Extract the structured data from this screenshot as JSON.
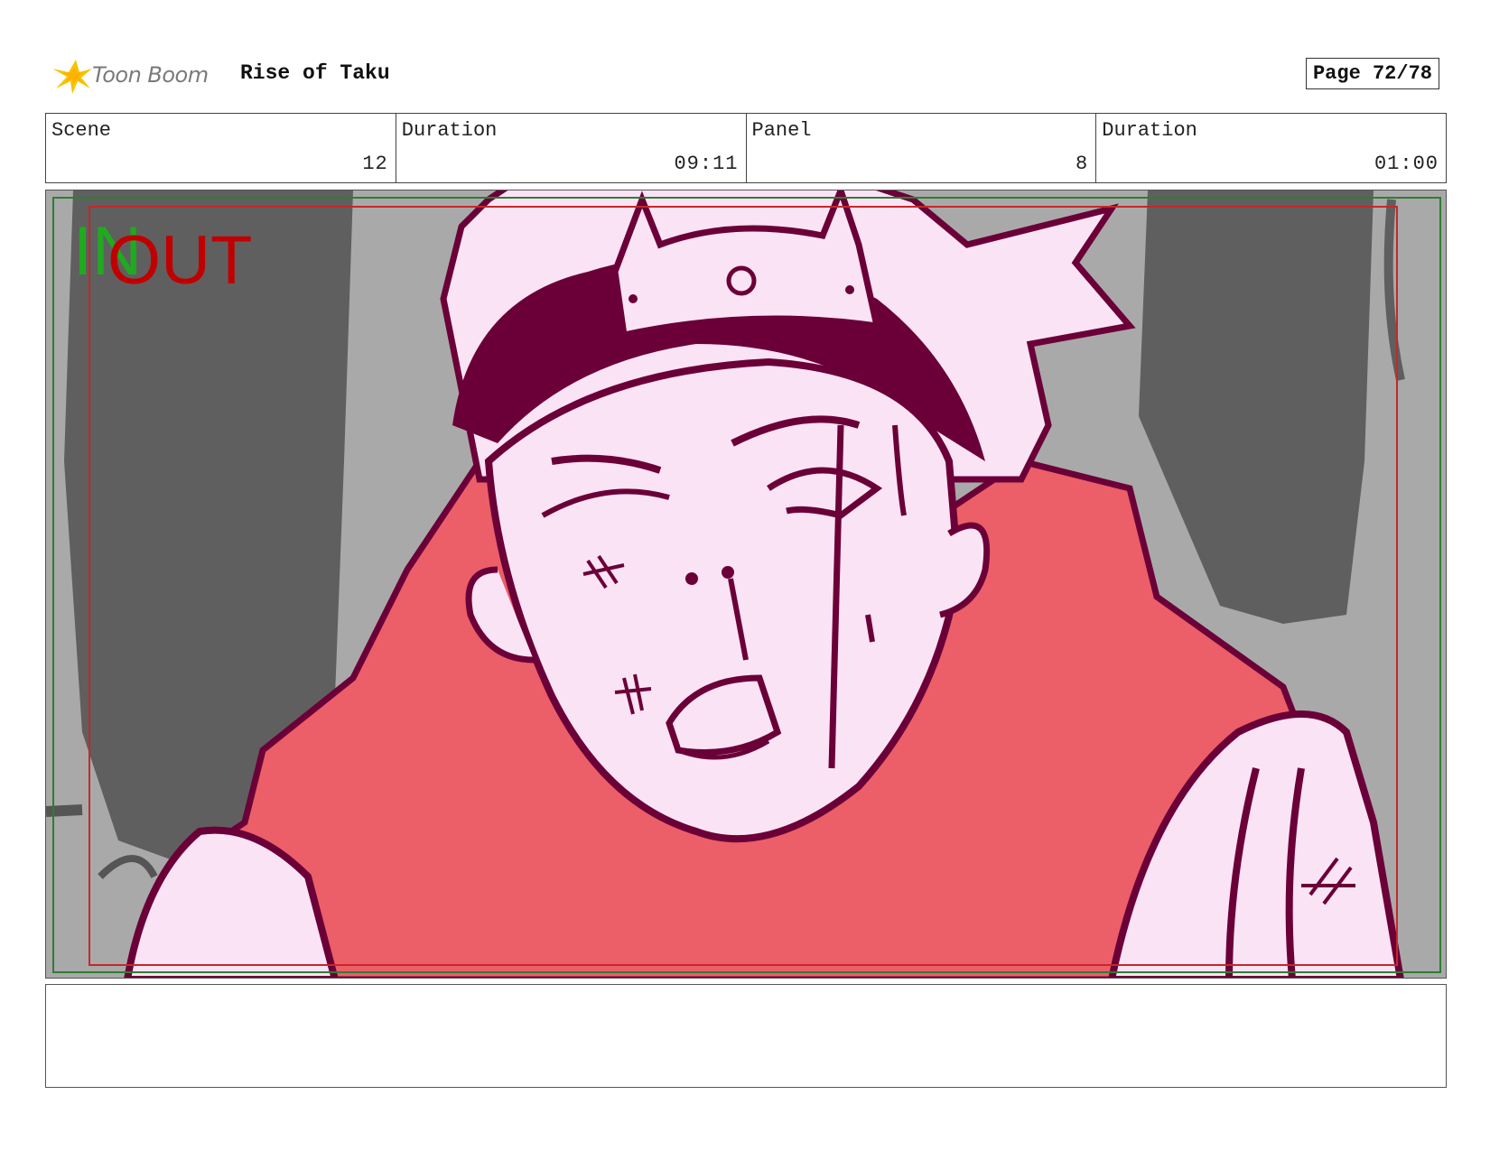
{
  "header": {
    "brand": "Toon Boom",
    "project_title": "Rise of Taku",
    "page_label": "Page 72/78"
  },
  "info": {
    "scene_label": "Scene",
    "scene_value": "12",
    "scene_duration_label": "Duration",
    "scene_duration_value": "09:11",
    "panel_label": "Panel",
    "panel_value": "8",
    "panel_duration_label": "Duration",
    "panel_duration_value": "01:00"
  },
  "panel": {
    "in_marker": "IN",
    "out_marker": "OUT",
    "safe_frame_color": "#2e7d32",
    "title_safe_color": "#c62828",
    "skin_color": "#fbe3f6",
    "line_color": "#6b0038",
    "scarf_color": "#ec5f68"
  },
  "caption": {
    "text": ""
  }
}
